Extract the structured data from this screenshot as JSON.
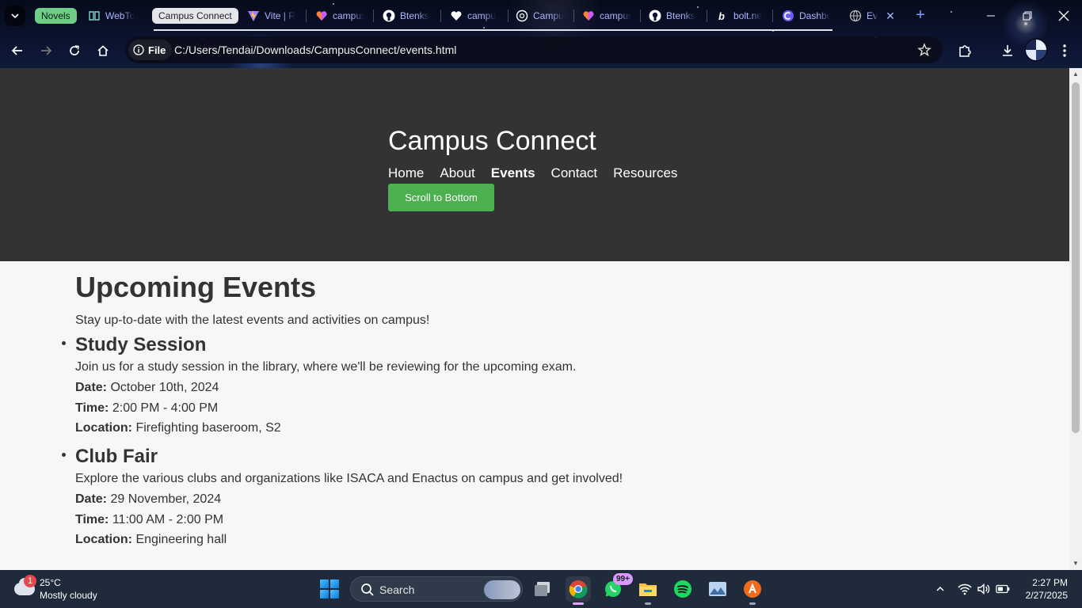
{
  "browser": {
    "tabs": [
      {
        "label": "Novels",
        "type": "group"
      },
      {
        "label": "WebTo",
        "type": "tab",
        "icon": "book-icon"
      },
      {
        "label": "Campus Connect",
        "type": "group"
      },
      {
        "label": "Vite | R",
        "type": "tab",
        "icon": "vite-icon"
      },
      {
        "label": "campus",
        "type": "tab",
        "icon": "lovable-heart-icon"
      },
      {
        "label": "Btenks",
        "type": "tab",
        "icon": "github-icon"
      },
      {
        "label": "campu",
        "type": "tab",
        "icon": "heart-icon"
      },
      {
        "label": "Campu",
        "type": "tab",
        "icon": "chatgpt-icon"
      },
      {
        "label": "campus",
        "type": "tab",
        "icon": "lovable-heart-icon"
      },
      {
        "label": "Btenks",
        "type": "tab",
        "icon": "github-icon"
      },
      {
        "label": "bolt.ne",
        "type": "tab",
        "icon": "bolt-icon"
      },
      {
        "label": "Dashbo",
        "type": "tab",
        "icon": "cursor-icon"
      },
      {
        "label": "Ev",
        "type": "tab",
        "icon": "globe-icon",
        "active": true
      }
    ],
    "address": {
      "scheme_label": "File",
      "url": "C:/Users/Tendai/Downloads/CampusConnect/events.html"
    }
  },
  "site": {
    "title": "Campus Connect",
    "nav": [
      "Home",
      "About",
      "Events",
      "Contact",
      "Resources"
    ],
    "active_nav": "Events",
    "scroll_button": "Scroll to Bottom",
    "accent": "#4caf50",
    "header_bg": "#333333"
  },
  "page": {
    "heading": "Upcoming Events",
    "intro": "Stay up-to-date with the latest events and activities on campus!",
    "labels": {
      "date": "Date:",
      "time": "Time:",
      "location": "Location:"
    },
    "events": [
      {
        "title": "Study Session",
        "description": "Join us for a study session in the library, where we'll be reviewing for the upcoming exam.",
        "date": "October 10th, 2024",
        "time": "2:00 PM - 4:00 PM",
        "location": "Firefighting baseroom, S2"
      },
      {
        "title": "Club Fair",
        "description": "Explore the various clubs and organizations like ISACA and Enactus on campus and get involved!",
        "date": "29 November, 2024",
        "time": "11:00 AM - 2:00 PM",
        "location": "Engineering hall"
      }
    ]
  },
  "taskbar": {
    "weather": {
      "badge": "1",
      "temp": "25°C",
      "condition": "Mostly cloudy"
    },
    "search_placeholder": "Search",
    "whatsapp_badge": "99+",
    "clock": {
      "time": "2:27 PM",
      "date": "2/27/2025"
    }
  }
}
